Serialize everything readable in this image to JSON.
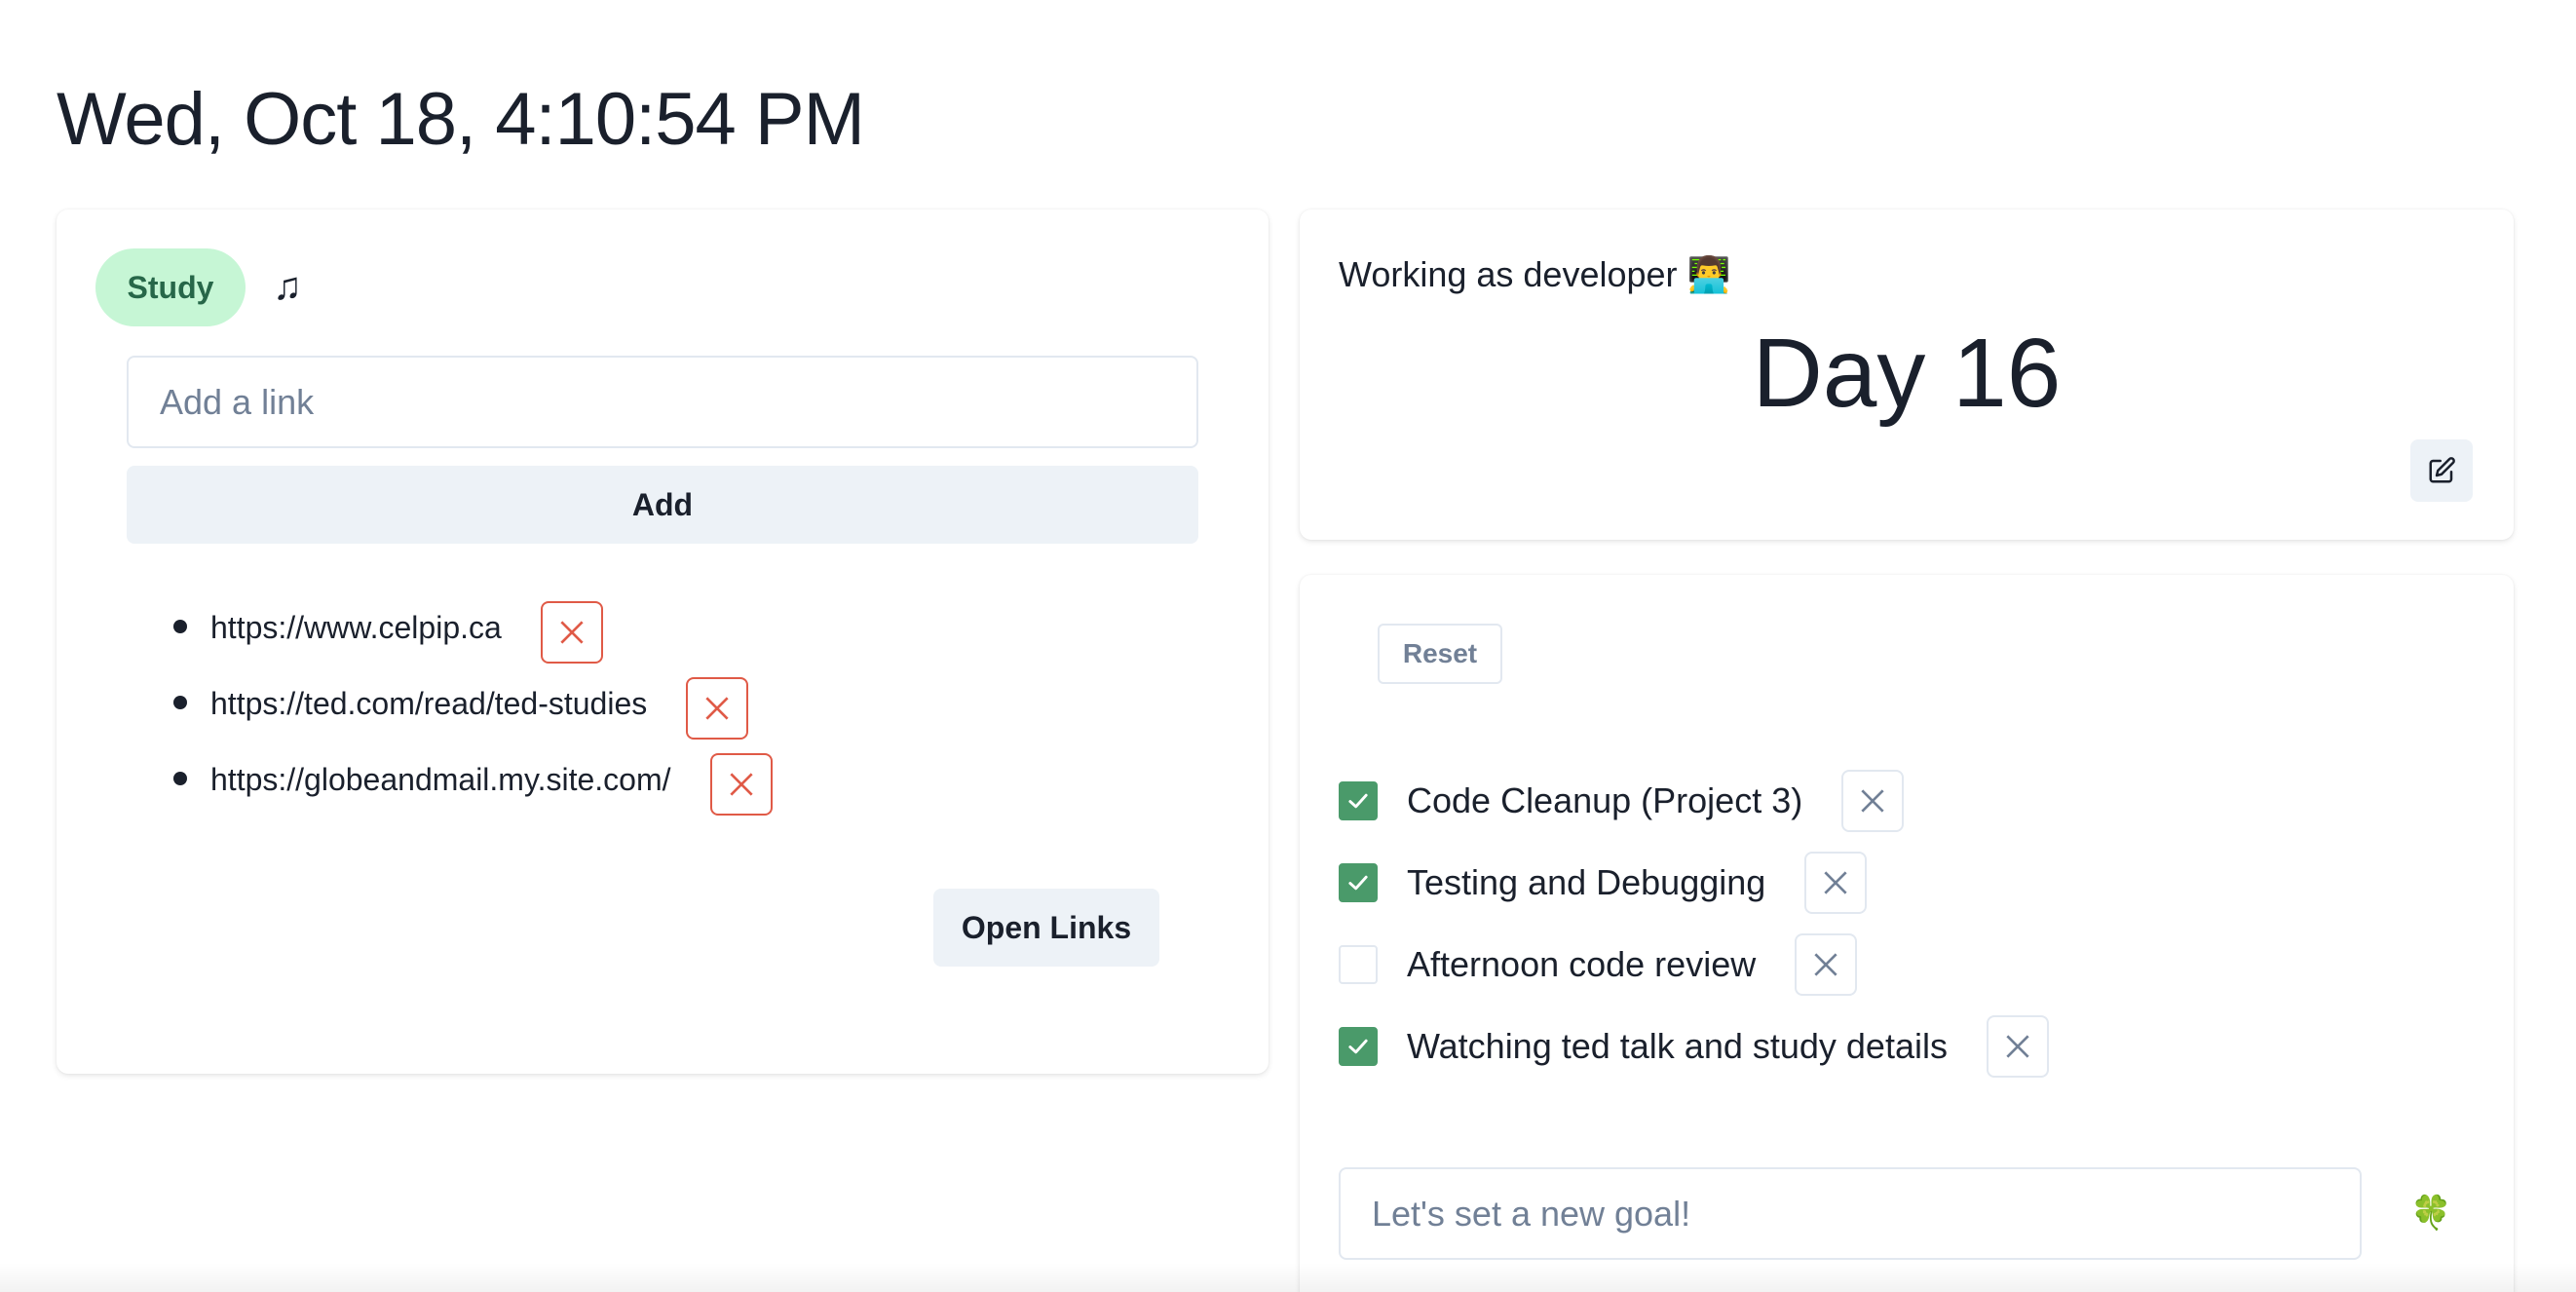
{
  "header": {
    "datetime": "Wed, Oct 18, 4:10:54 PM"
  },
  "links_card": {
    "category": "Study",
    "music_icon": "♫",
    "input_placeholder": "Add a link",
    "input_value": "",
    "add_label": "Add",
    "links": [
      {
        "url": "https://www.celpip.ca"
      },
      {
        "url": "https://ted.com/read/ted-studies"
      },
      {
        "url": "https://globeandmail.my.site.com/"
      }
    ],
    "open_label": "Open Links",
    "delete_color": "#e05a47"
  },
  "day_card": {
    "role": "Working as developer 👨‍💻",
    "day": "Day 16"
  },
  "goals_card": {
    "reset_label": "Reset",
    "goals": [
      {
        "text": "Code Cleanup (Project 3)",
        "checked": true
      },
      {
        "text": "Testing and Debugging",
        "checked": true
      },
      {
        "text": "Afternoon code review",
        "checked": false
      },
      {
        "text": "Watching ted talk and study details",
        "checked": true
      }
    ],
    "goal_placeholder": "Let's set a new goal!",
    "goal_value": "",
    "clover_icon": "🍀",
    "check_color": "#4a9a6a"
  }
}
